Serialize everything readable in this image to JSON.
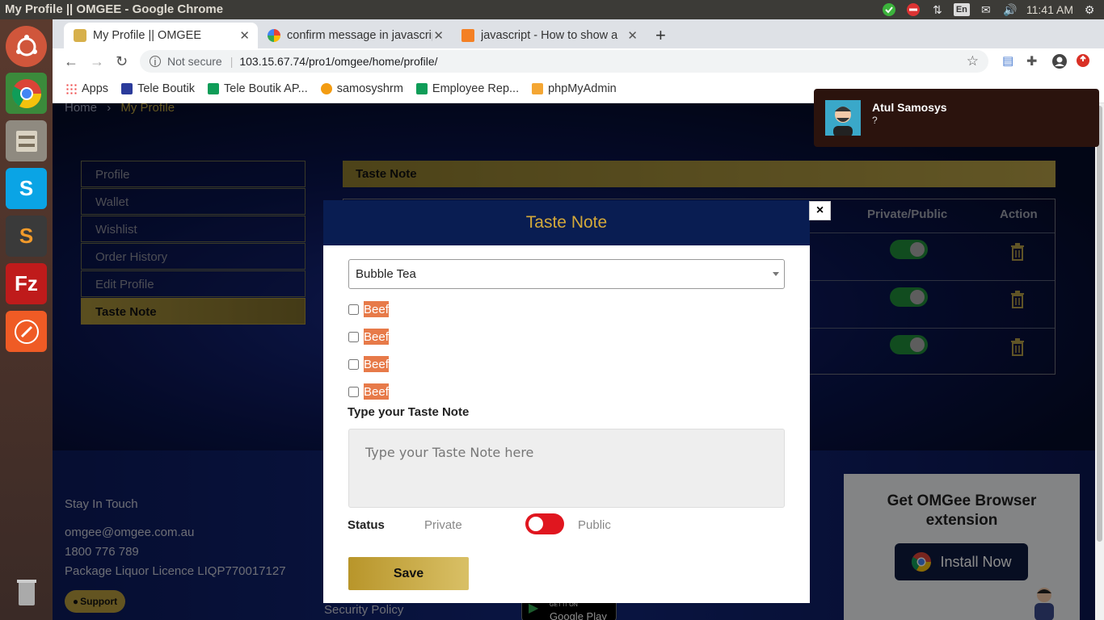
{
  "os": {
    "window_title": "My Profile || OMGEE - Google Chrome",
    "lang": "En",
    "time": "11:41 AM"
  },
  "browser": {
    "tabs": [
      {
        "label": "My Profile || OMGEE",
        "active": true
      },
      {
        "label": "confirm message in javascript",
        "active": false
      },
      {
        "label": "javascript - How to show a",
        "active": false
      }
    ],
    "url_security": "Not secure",
    "url": "103.15.67.74/pro1/omgee/home/profile/",
    "bookmarks": [
      "Apps",
      "Tele Boutik",
      "Tele Boutik AP...",
      "samosyshrm",
      "Employee Rep...",
      "phpMyAdmin"
    ]
  },
  "page": {
    "breadcrumb": {
      "home": "Home",
      "sep": "›",
      "current": "My Profile"
    },
    "sidebar": [
      "Profile",
      "Wallet",
      "Wishlist",
      "Order History",
      "Edit Profile",
      "Taste Note"
    ],
    "panel_title": "Taste Note",
    "table_headers": {
      "privacy": "Private/Public",
      "action": "Action"
    },
    "footer": {
      "stay": "Stay In Touch",
      "email": "omgee@omgee.com.au",
      "phone": "1800 776 789",
      "licence": "Package Liquor Licence LIQP770017127",
      "support": "Support",
      "security": "Security Policy",
      "ext_title": "Get OMGee Browser extension",
      "ext_button": "Install Now",
      "gplay_small": "GET IT ON",
      "gplay_big": "Google Play"
    }
  },
  "notification": {
    "name": "Atul Samosys",
    "message": "?"
  },
  "modal": {
    "title": "Taste Note",
    "close": "×",
    "select_value": "Bubble Tea",
    "options": [
      "Beef",
      "Beef",
      "Beef",
      "Beef"
    ],
    "note_label": "Type your Taste Note",
    "note_placeholder": "Type your Taste Note here",
    "status_label": "Status",
    "private": "Private",
    "public": "Public",
    "save": "Save"
  },
  "colors": {
    "gold": "#b8952a",
    "navy": "#091d52",
    "toggle_off": "#e0161f",
    "toggle_on": "#1f8a3a",
    "chip": "#e77a49"
  }
}
